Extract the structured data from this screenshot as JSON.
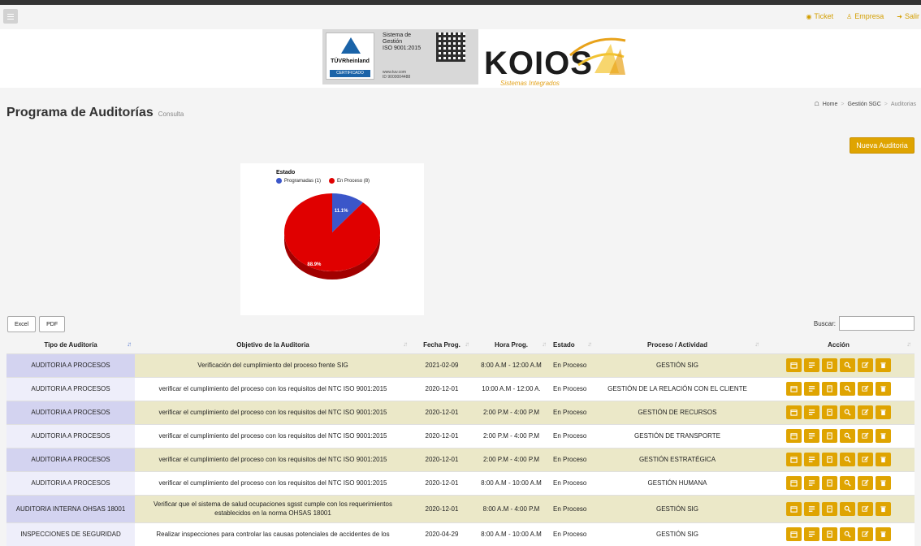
{
  "topbar": {
    "links": [
      {
        "icon": "ticket-icon",
        "label": "Ticket"
      },
      {
        "icon": "user-icon",
        "label": "Empresa"
      },
      {
        "icon": "logout-icon",
        "label": "Salir"
      }
    ]
  },
  "logos": {
    "tuv": {
      "brand": "TÜVRheinland",
      "badge": "CERTIFICADO",
      "text_lines": [
        "Sistema de",
        "Gestión",
        "ISO 9001:2015"
      ],
      "web": "www.tuv.com",
      "id": "ID 9000004488"
    },
    "koios": {
      "word": "KOIOS",
      "tagline": "Sistemas Integrados"
    }
  },
  "page": {
    "title": "Programa de Auditorías",
    "subtitle": "Consulta",
    "breadcrumb": [
      "Home",
      "Gestión SGC",
      "Auditorias"
    ],
    "new_button": "Nueva Auditoria"
  },
  "chart_data": {
    "type": "pie",
    "title": "Estado",
    "slices": [
      {
        "name": "Programadas (1)",
        "value": 1,
        "percent": 11.1,
        "color": "#3b56c9"
      },
      {
        "name": "En Proceso (8)",
        "value": 8,
        "percent": 88.9,
        "color": "#e00000"
      }
    ],
    "labels": [
      "11.1%",
      "88.9%"
    ],
    "legend_placement": "top"
  },
  "toolbar": {
    "excel": "Excel",
    "pdf": "PDF",
    "search_label": "Buscar:",
    "search_value": ""
  },
  "table": {
    "headers": [
      "Tipo de Auditoría",
      "Objetivo de la Auditoria",
      "Fecha Prog.",
      "Hora Prog.",
      "Estado",
      "Proceso / Actividad",
      "Acción"
    ],
    "rows": [
      [
        "AUDITORIA A PROCESOS",
        "Verificación del cumplimiento del proceso frente SIG",
        "2021-02-09",
        "8:00 A.M - 12:00 A.M",
        "En Proceso",
        "GESTIÓN SIG"
      ],
      [
        "AUDITORIA A PROCESOS",
        "verificar el cumplimiento del proceso con los requisitos del NTC ISO 9001:2015",
        "2020-12-01",
        "10:00 A.M - 12:00 A.",
        "En Proceso",
        "GESTIÓN DE LA RELACIÓN CON EL CLIENTE"
      ],
      [
        "AUDITORIA A PROCESOS",
        "verificar el cumplimiento del proceso con los requisitos del NTC ISO 9001:2015",
        "2020-12-01",
        "2:00 P.M - 4:00 P.M",
        "En Proceso",
        "GESTIÓN DE RECURSOS"
      ],
      [
        "AUDITORIA A PROCESOS",
        "verificar el cumplimiento del proceso con los requisitos del NTC ISO 9001:2015",
        "2020-12-01",
        "2:00 P.M - 4:00 P.M",
        "En Proceso",
        "GESTIÓN DE TRANSPORTE"
      ],
      [
        "AUDITORIA A PROCESOS",
        "verificar el cumplimiento del proceso con los requisitos del NTC ISO 9001:2015",
        "2020-12-01",
        "2:00 P.M - 4:00 P.M",
        "En Proceso",
        "GESTIÓN ESTRATÉGICA"
      ],
      [
        "AUDITORIA A PROCESOS",
        "verificar el cumplimiento del proceso con los requisitos del NTC ISO 9001:2015",
        "2020-12-01",
        "8:00 A.M - 10:00 A.M",
        "En Proceso",
        "GESTIÓN HUMANA"
      ],
      [
        "AUDITORIA INTERNA OHSAS 18001",
        "Verificar que el sistema de salud ocupaciones sgsst cumple con los requerimientos establecidos en la norma OHSAS 18001",
        "2020-12-01",
        "8:00 A.M - 4:00 P.M",
        "En Proceso",
        "GESTIÓN SIG"
      ],
      [
        "INSPECCIONES DE SEGURIDAD",
        "Realizar inspecciones para controlar las causas potenciales de accidentes de los",
        "2020-04-29",
        "8:00 A.M - 10:00 A.M",
        "En Proceso",
        "GESTIÓN SIG"
      ]
    ],
    "actions": [
      "calendar-icon",
      "list-icon",
      "document-icon",
      "search-icon",
      "edit-icon",
      "trash-icon"
    ]
  },
  "colors": {
    "accent": "#dfa401",
    "row_alt": "#ebe8c8",
    "pie_blue": "#3b56c9",
    "pie_red": "#e00000"
  }
}
